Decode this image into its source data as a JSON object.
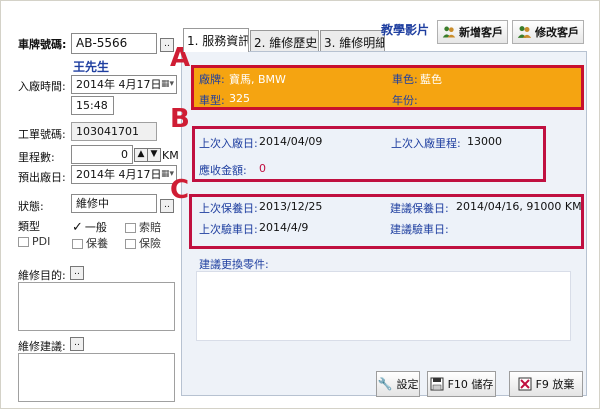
{
  "left": {
    "plate_label": "車牌號碼:",
    "plate_value": "AB-5566",
    "plate_btn": "..",
    "owner_name": "王先生",
    "checkin_label": "入廠時間:",
    "checkin_date": "2014年  4月17日",
    "checkin_time": "15:48",
    "order_label": "工單號碼:",
    "order_value": "103041701",
    "mileage_label": "里程數:",
    "mileage_value": "0",
    "mileage_unit": "KM",
    "checkout_label": "預出廠日:",
    "checkout_date": "2014年  4月17日",
    "status_label": "狀態:",
    "status_value": "維修中",
    "status_btn": "..",
    "type_label": "類型",
    "types": [
      {
        "label": "一般",
        "checked": true
      },
      {
        "label": "索賠",
        "checked": false
      },
      {
        "label": "PDI",
        "checked": false
      },
      {
        "label": "保養",
        "checked": false
      },
      {
        "label": "保險",
        "checked": false
      }
    ],
    "purpose_label": "維修目的:",
    "purpose_btn": "..",
    "advice_label": "維修建議:",
    "advice_btn": ".."
  },
  "tabs": [
    {
      "label": "1. 服務資訊",
      "active": true
    },
    {
      "label": "2. 維修歷史",
      "active": false
    },
    {
      "label": "3. 維修明細",
      "active": false
    }
  ],
  "top": {
    "video_link": "教學影片",
    "add_customer": "新增客戶",
    "edit_customer": "修改客戶"
  },
  "section_a": {
    "brand_label": "廠牌:",
    "brand_value": "寶馬, BMW",
    "color_label": "車色:",
    "color_value": "藍色",
    "model_label": "車型:",
    "model_value": "325",
    "year_label": "年份:",
    "year_value": ""
  },
  "section_b": {
    "last_in_label": "上次入廠日:",
    "last_in_value": "2014/04/09",
    "last_mileage_label": "上次入廠里程:",
    "last_mileage_value": "13000",
    "receivable_label": "應收金額:",
    "receivable_value": "0"
  },
  "section_c": {
    "last_maint_label": "上次保養日:",
    "last_maint_value": "2013/12/25",
    "sugg_maint_label": "建議保養日:",
    "sugg_maint_value": "2014/04/16, 91000 KM",
    "last_inspect_label": "上次驗車日:",
    "last_inspect_value": "2014/4/9",
    "sugg_inspect_label": "建議驗車日:",
    "sugg_inspect_value": ""
  },
  "parts_label": "建議更換零件:",
  "markers": {
    "a": "A",
    "b": "B",
    "c": "C"
  },
  "buttons": {
    "settings": "設定",
    "save": "F10 儲存",
    "discard": "F9 放棄"
  },
  "colors": {
    "accent_orange": "#f5a411",
    "annotation_red": "#c8102e",
    "label_blue": "#1f3fa0"
  }
}
